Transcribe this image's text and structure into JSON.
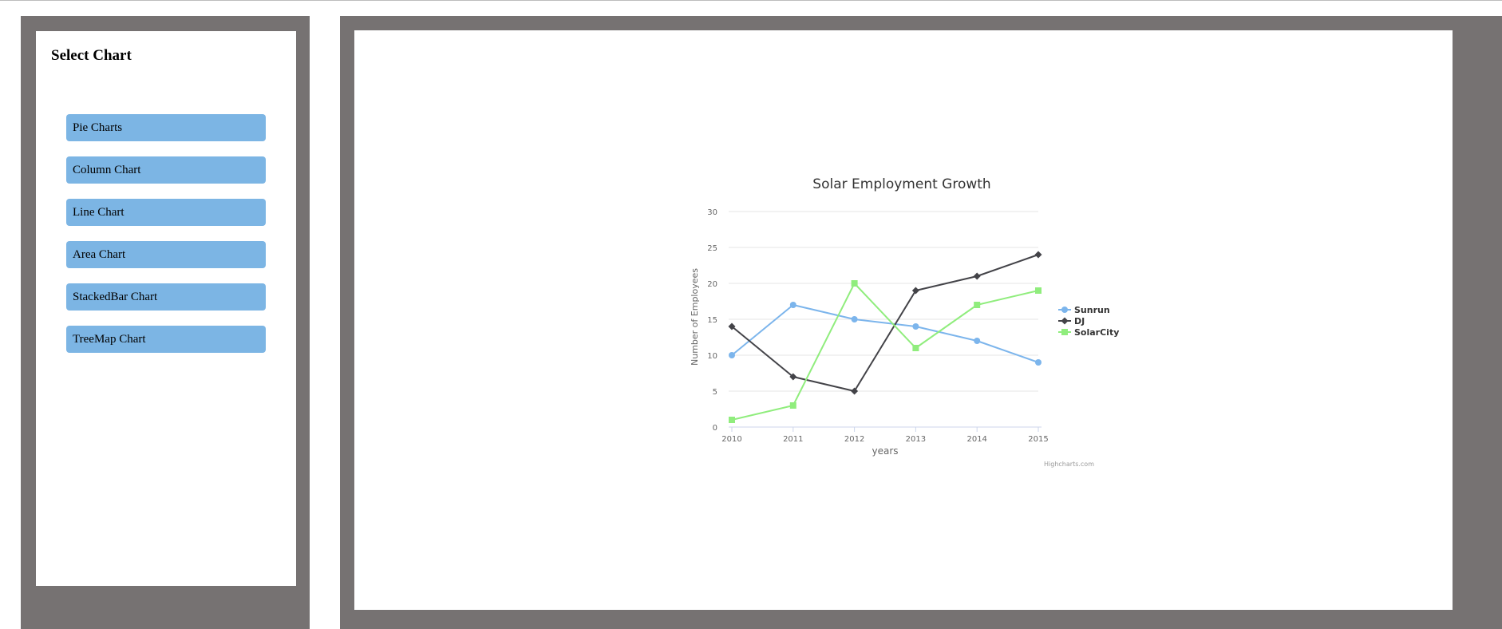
{
  "sidebar": {
    "title": "Select Chart",
    "items": [
      {
        "label": "Pie Charts"
      },
      {
        "label": "Column Chart"
      },
      {
        "label": "Line Chart"
      },
      {
        "label": "Area Chart"
      },
      {
        "label": "StackedBar Chart"
      },
      {
        "label": "TreeMap Chart"
      }
    ],
    "button_color": "#7cb5e4"
  },
  "chart_data": {
    "type": "line",
    "title": "Solar Employment Growth",
    "xlabel": "years",
    "ylabel": "Number of Employees",
    "x": [
      2010,
      2011,
      2012,
      2013,
      2014,
      2015
    ],
    "ylim": [
      0,
      30
    ],
    "yticks": [
      0,
      5,
      10,
      15,
      20,
      25,
      30
    ],
    "grid": true,
    "legend_position": "right",
    "credits": "Highcharts.com",
    "series": [
      {
        "name": "Sunrun",
        "color": "#7cb5ec",
        "marker": "circle",
        "values": [
          10,
          17,
          15,
          14,
          12,
          9
        ]
      },
      {
        "name": "DJ",
        "color": "#434348",
        "marker": "diamond",
        "values": [
          14,
          7,
          5,
          19,
          21,
          24
        ]
      },
      {
        "name": "SolarCity",
        "color": "#90ed7d",
        "marker": "square",
        "values": [
          1,
          3,
          20,
          11,
          17,
          19
        ]
      }
    ]
  }
}
